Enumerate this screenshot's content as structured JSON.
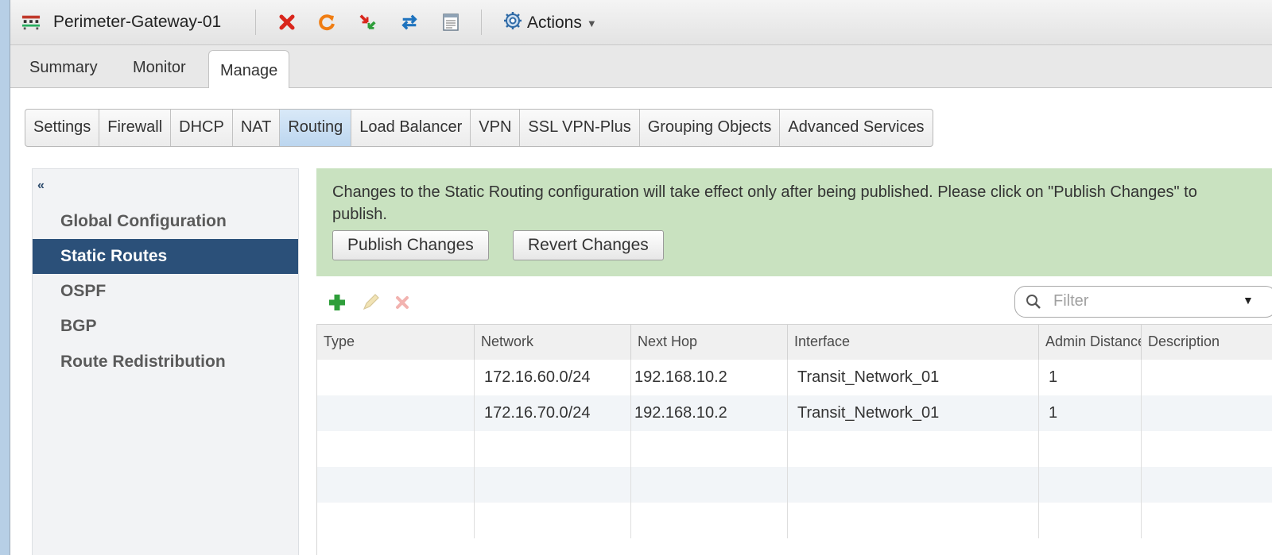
{
  "window": {
    "title": "Perimeter-Gateway-01",
    "actions_label": "Actions",
    "toolbar_icons": [
      "edge-icon",
      "delete-icon",
      "refresh-icon",
      "migrate-icon",
      "sync-icon",
      "log-icon",
      "actions-gear-icon"
    ]
  },
  "top_tabs": [
    {
      "label": "Summary"
    },
    {
      "label": "Monitor"
    },
    {
      "label": "Manage",
      "active": true
    }
  ],
  "sub_tabs": [
    {
      "label": "Settings"
    },
    {
      "label": "Firewall"
    },
    {
      "label": "DHCP"
    },
    {
      "label": "NAT"
    },
    {
      "label": "Routing",
      "active": true
    },
    {
      "label": "Load Balancer"
    },
    {
      "label": "VPN"
    },
    {
      "label": "SSL VPN-Plus"
    },
    {
      "label": "Grouping Objects"
    },
    {
      "label": "Advanced Services"
    }
  ],
  "sidebar": {
    "collapse_glyph": "«",
    "items": [
      {
        "label": "Global Configuration"
      },
      {
        "label": "Static Routes",
        "active": true
      },
      {
        "label": "OSPF"
      },
      {
        "label": "BGP"
      },
      {
        "label": "Route Redistribution"
      }
    ]
  },
  "notice": {
    "text": "Changes to the Static Routing configuration will take effect only after being published. Please click on \"Publish Changes\" to publish.",
    "publish_label": "Publish Changes",
    "revert_label": "Revert Changes",
    "background": "#c9e2c0"
  },
  "grid_toolbar": {
    "icons": [
      "add-icon",
      "edit-icon",
      "delete-icon"
    ],
    "filter_placeholder": "Filter"
  },
  "table": {
    "columns": [
      "Type",
      "Network",
      "Next Hop",
      "Interface",
      "Admin Distance",
      "Description"
    ],
    "rows": [
      [
        "",
        "172.16.60.0/24",
        "192.168.10.2",
        "Transit_Network_01",
        "1",
        ""
      ],
      [
        "",
        "172.16.70.0/24",
        "192.168.10.2",
        "Transit_Network_01",
        "1",
        ""
      ]
    ]
  },
  "colors": {
    "accent": "#2b5079",
    "active_subtab": "#bcd6ef"
  }
}
